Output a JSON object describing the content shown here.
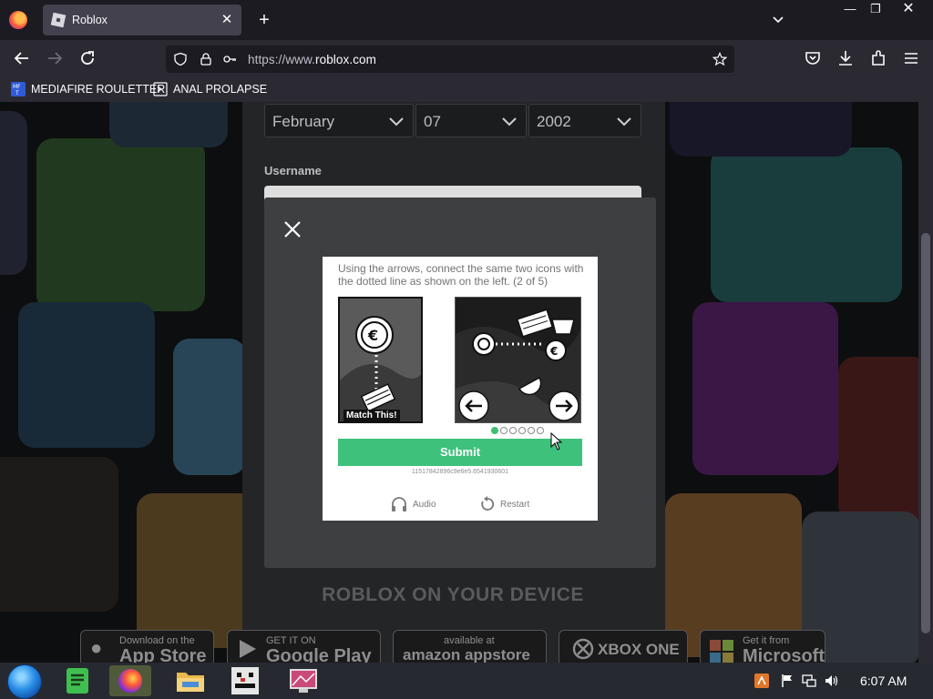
{
  "browser": {
    "tab_title": "Roblox",
    "url_protocol": "https://www.",
    "url_host": "roblox.com",
    "bookmarks": [
      {
        "label": "MEDIAFIRE ROULETTER",
        "icon": "mediafire-favicon"
      },
      {
        "label": "ANAL PROLAPSE",
        "icon": "generic-favicon"
      }
    ]
  },
  "form": {
    "birth_month": "February",
    "birth_day": "07",
    "birth_year": "2002",
    "username_label": "Username"
  },
  "captcha": {
    "instruction": "Using the arrows, connect the same two icons with the dotted line as shown on the left. (2 of 5)",
    "match_label": "Match This!",
    "submit_label": "Submit",
    "session_id": "11517842896c9e6e5.6541930601",
    "audio_label": "Audio",
    "restart_label": "Restart",
    "step_current": 1,
    "step_total": 6
  },
  "page": {
    "device_heading": "ROBLOX ON YOUR DEVICE",
    "stores": [
      {
        "small": "Download on the",
        "big": "App Store"
      },
      {
        "small": "GET IT ON",
        "big": "Google Play"
      },
      {
        "small": "available at",
        "big": "amazon appstore"
      },
      {
        "small": "",
        "big": "XBOX ONE"
      },
      {
        "small": "Get it from",
        "big": "Microsoft"
      }
    ]
  },
  "taskbar": {
    "clock": "6:07 AM"
  },
  "colors": {
    "submit_green": "#3ec27b",
    "chrome_dark": "#1c1b22",
    "toolbar": "#2b2a33"
  }
}
